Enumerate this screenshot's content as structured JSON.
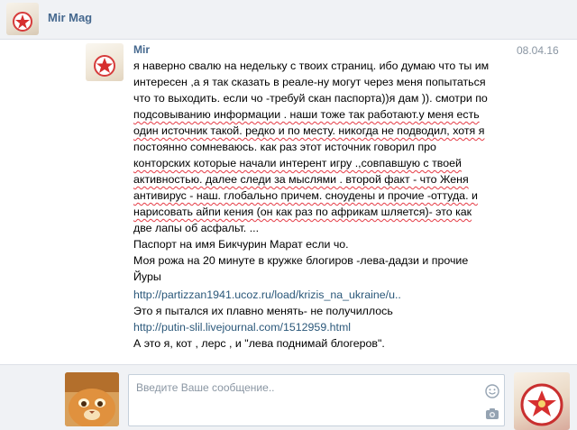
{
  "header": {
    "title": "Mir Mag"
  },
  "message": {
    "author": "Mir",
    "date": "08.04.16",
    "lines": [
      "я наверно свалю на недельку с твоих страниц. ибо думаю что ты им",
      "интересен ,а я так сказать в реале-ну могут через меня попытаться",
      "что то выходить. если чо -требуй скан паспорта))я дам )). смотри по",
      "подсовыванию информации . наши тоже так работают.у меня есть",
      "один источник такой. редко и по месту. никогда не подводил, хотя я",
      "постоянно сомневаюсь. как раз этот источник говорил про",
      "конторских которые начали интерент игру .,совпавшую с твоей",
      "активностью. далее следи за мыслями . второй факт - что Женя",
      "антивирус - наш. глобально причем. сноудены и прочие -оттуда. и",
      "нарисовать айпи кения (он как раз по африкам шляется)- это как",
      "две лапы об асфальт. ...",
      "Паспорт на имя Бикчурин Марат если чо.",
      "Моя рожа на 20 минуте в кружке блогиров -лева-дадзи и прочие",
      "Йуры"
    ],
    "link1": "http://partizzan1941.ucoz.ru/load/krizis_na_ukraine/u..",
    "line_after_link1": "Это я пытался их плавно менять- не получиллось",
    "link2": "http://putin-slil.livejournal.com/1512959.html",
    "line_after_link2": "А это я, кот , лерс , и \"лева поднимай блогеров\"."
  },
  "composer": {
    "placeholder": "Введите Ваше сообщение.."
  },
  "icons": {
    "emoji": "smile-icon",
    "attach": "camera-icon"
  },
  "colors": {
    "link": "#2b587a",
    "name": "#45688e",
    "spellcheck": "#e53b45"
  }
}
